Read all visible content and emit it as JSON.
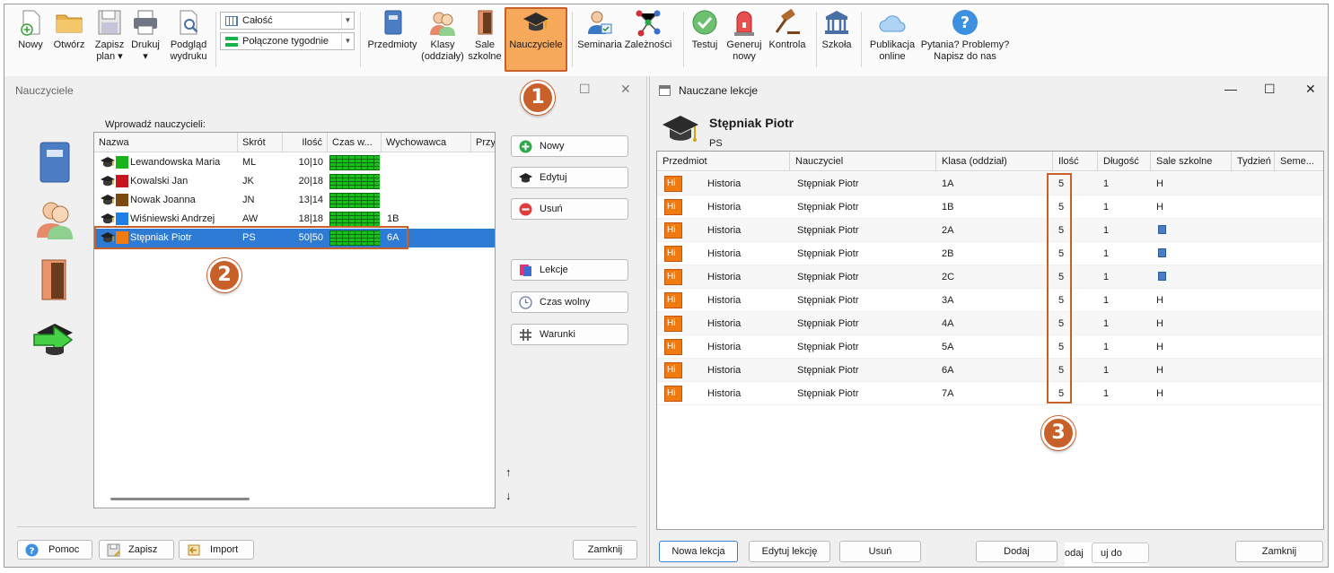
{
  "toolbar": {
    "file": [
      {
        "label": "Nowy",
        "icon": "new-document-icon"
      },
      {
        "label": "Otwórz",
        "icon": "folder-icon"
      },
      {
        "label": "Zapisz\nplan ▾",
        "icon": "save-icon"
      },
      {
        "label": "Drukuj\n▾",
        "icon": "printer-icon"
      },
      {
        "label": "Podgląd\nwydruku",
        "icon": "print-preview-icon"
      }
    ],
    "view_select": {
      "value": "Całość"
    },
    "week_select": {
      "value": "Połączone tygodnie"
    },
    "data": [
      {
        "label": "Przedmioty",
        "icon": "book-icon"
      },
      {
        "label": "Klasy\n(oddziały)",
        "icon": "class-icon"
      },
      {
        "label": "Sale\nszkolne",
        "icon": "door-icon"
      },
      {
        "label": "Nauczyciele",
        "icon": "graduation-cap-icon"
      }
    ],
    "specs": [
      {
        "label": "Seminaria",
        "icon": "seminar-icon"
      },
      {
        "label": "Zależności",
        "icon": "network-icon"
      }
    ],
    "gen": [
      {
        "label": "Testuj",
        "icon": "check-icon"
      },
      {
        "label": "Generuj\nnowy",
        "icon": "siren-icon"
      },
      {
        "label": "Kontrola",
        "icon": "gavel-icon"
      }
    ],
    "school": {
      "label": "Szkoła",
      "icon": "building-icon"
    },
    "publish": {
      "label": "Publikacja\nonline",
      "icon": "cloud-icon"
    },
    "help": {
      "label": "Pytania? Problemy?\nNapisz do nas",
      "icon": "question-icon"
    }
  },
  "annotations": {
    "b1": "1",
    "b2": "2",
    "b3": "3"
  },
  "teachers_window": {
    "title": "Nauczyciele",
    "prompt": "Wprowadź nauczycieli:",
    "columns": [
      "Nazwa",
      "Skrót",
      "Ilość",
      "Czas w...",
      "Wychowawca",
      "Przy"
    ],
    "rows": [
      {
        "name": "Lewandowska Maria",
        "abbr": "ML",
        "count": "10|10",
        "tutor": "",
        "color": "#19b31c"
      },
      {
        "name": "Kowalski Jan",
        "abbr": "JK",
        "count": "20|18",
        "tutor": "",
        "color": "#c4161c"
      },
      {
        "name": "Nowak Joanna",
        "abbr": "JN",
        "count": "13|14",
        "tutor": "",
        "color": "#7a4a12"
      },
      {
        "name": "Wiśniewski Andrzej",
        "abbr": "AW",
        "count": "18|18",
        "tutor": "1B",
        "color": "#1f7ee8"
      },
      {
        "name": "Stępniak Piotr",
        "abbr": "PS",
        "count": "50|50",
        "tutor": "6A",
        "color": "#f07c10"
      }
    ],
    "buttons": {
      "new": "Nowy",
      "edit": "Edytuj",
      "delete": "Usuń",
      "lessons": "Lekcje",
      "free_time": "Czas wolny",
      "conditions": "Warunki"
    },
    "arrows": {
      "up": "↑",
      "down": "↓"
    },
    "footer": {
      "help": "Pomoc",
      "save": "Zapisz",
      "import": "Import",
      "close": "Zamknij"
    }
  },
  "lessons_window": {
    "title": "Nauczane lekcje",
    "teacher": "Stępniak Piotr",
    "abbr": "PS",
    "columns": [
      "Przedmiot",
      "Nauczyciel",
      "Klasa (oddział)",
      "Ilość",
      "Długość",
      "Sale szkolne",
      "Tydzień",
      "Seme..."
    ],
    "rows": [
      {
        "subj": "Hi",
        "subject": "Historia",
        "teacher": "Stępniak Piotr",
        "class": "1A",
        "count": "5",
        "length": "1",
        "room": "H"
      },
      {
        "subj": "Hi",
        "subject": "Historia",
        "teacher": "Stępniak Piotr",
        "class": "1B",
        "count": "5",
        "length": "1",
        "room": "H"
      },
      {
        "subj": "Hi",
        "subject": "Historia",
        "teacher": "Stępniak Piotr",
        "class": "2A",
        "count": "5",
        "length": "1",
        "room": ""
      },
      {
        "subj": "Hi",
        "subject": "Historia",
        "teacher": "Stępniak Piotr",
        "class": "2B",
        "count": "5",
        "length": "1",
        "room": ""
      },
      {
        "subj": "Hi",
        "subject": "Historia",
        "teacher": "Stępniak Piotr",
        "class": "2C",
        "count": "5",
        "length": "1",
        "room": ""
      },
      {
        "subj": "Hi",
        "subject": "Historia",
        "teacher": "Stępniak Piotr",
        "class": "3A",
        "count": "5",
        "length": "1",
        "room": "H"
      },
      {
        "subj": "Hi",
        "subject": "Historia",
        "teacher": "Stępniak Piotr",
        "class": "4A",
        "count": "5",
        "length": "1",
        "room": "H"
      },
      {
        "subj": "Hi",
        "subject": "Historia",
        "teacher": "Stępniak Piotr",
        "class": "5A",
        "count": "5",
        "length": "1",
        "room": "H"
      },
      {
        "subj": "Hi",
        "subject": "Historia",
        "teacher": "Stępniak Piotr",
        "class": "6A",
        "count": "5",
        "length": "1",
        "room": "H"
      },
      {
        "subj": "Hi",
        "subject": "Historia",
        "teacher": "Stępniak Piotr",
        "class": "7A",
        "count": "5",
        "length": "1",
        "room": "H"
      }
    ],
    "footer": {
      "new_lesson": "Nowa lekcja",
      "edit_lesson": "Edytuj lekcję",
      "delete": "Usuń",
      "add": "Dodaj",
      "odaj": "odaj",
      "uj_do": "uj do",
      "close": "Zamknij"
    }
  }
}
